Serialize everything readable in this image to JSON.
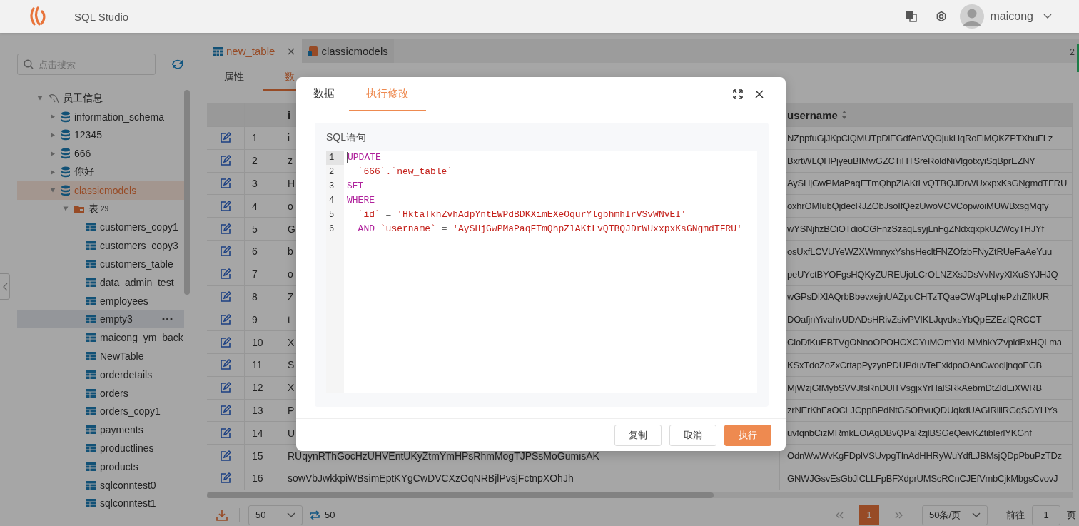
{
  "header": {
    "title": "SQL Studio",
    "user": "maicong"
  },
  "sidebar": {
    "search": {
      "placeholder": "点击搜索"
    },
    "tree": [
      {
        "label": "员工信息",
        "kind": "connection",
        "expanded": true,
        "selected": false,
        "children": [
          {
            "label": "information_schema",
            "kind": "database",
            "expanded": false,
            "selected": false
          },
          {
            "label": "12345",
            "kind": "database",
            "expanded": false,
            "selected": false
          },
          {
            "label": "666",
            "kind": "database",
            "expanded": false,
            "selected": false
          },
          {
            "label": "你好",
            "kind": "database",
            "expanded": false,
            "selected": false
          },
          {
            "label": "classicmodels",
            "kind": "database",
            "expanded": true,
            "selected": true,
            "children": [
              {
                "label": "表",
                "kind": "folder",
                "count": "29",
                "expanded": true,
                "selected": false,
                "children": [
                  {
                    "label": "customers_copy1",
                    "kind": "table",
                    "selected": false,
                    "hovered": false
                  },
                  {
                    "label": "customers_copy3",
                    "kind": "table",
                    "selected": false,
                    "hovered": false
                  },
                  {
                    "label": "customers_table",
                    "kind": "table",
                    "selected": false,
                    "hovered": false
                  },
                  {
                    "label": "data_admin_test",
                    "kind": "table",
                    "selected": false,
                    "hovered": false
                  },
                  {
                    "label": "employees",
                    "kind": "table",
                    "selected": false,
                    "hovered": false
                  },
                  {
                    "label": "empty3",
                    "kind": "table",
                    "selected": false,
                    "hovered": true
                  },
                  {
                    "label": "maicong_ym_back",
                    "kind": "table",
                    "selected": false,
                    "hovered": false
                  },
                  {
                    "label": "NewTable",
                    "kind": "table",
                    "selected": false,
                    "hovered": false
                  },
                  {
                    "label": "orderdetails",
                    "kind": "table",
                    "selected": false,
                    "hovered": false
                  },
                  {
                    "label": "orders",
                    "kind": "table",
                    "selected": false,
                    "hovered": false
                  },
                  {
                    "label": "orders_copy1",
                    "kind": "table",
                    "selected": false,
                    "hovered": false
                  },
                  {
                    "label": "payments",
                    "kind": "table",
                    "selected": false,
                    "hovered": false
                  },
                  {
                    "label": "productlines",
                    "kind": "table",
                    "selected": false,
                    "hovered": false
                  },
                  {
                    "label": "products",
                    "kind": "table",
                    "selected": false,
                    "hovered": false
                  },
                  {
                    "label": "sqlconntest0",
                    "kind": "table",
                    "selected": false,
                    "hovered": false
                  },
                  {
                    "label": "sqlconntest1",
                    "kind": "table",
                    "selected": false,
                    "hovered": false
                  }
                ]
              }
            ]
          }
        ]
      }
    ]
  },
  "editor_tabs": [
    {
      "label": "new_table",
      "kind": "table",
      "selected": true,
      "closable": true
    },
    {
      "label": "classicmodels",
      "kind": "database",
      "selected": false,
      "closable": false
    }
  ],
  "edge_label": "2",
  "view_tabs": [
    {
      "label": "属性",
      "selected": false
    },
    {
      "label": "数",
      "selected": true
    }
  ],
  "table": {
    "columns": [
      {
        "label": "i",
        "sortable": false
      },
      {
        "label": "username",
        "sortable": true
      }
    ],
    "rows": [
      {
        "number": "1",
        "id": "i",
        "username": "NZppfuGjJKpCiQMUTpDiEGdfAnVQOjukHqRoFlMQKZPTXhuFLz"
      },
      {
        "number": "2",
        "id": "z",
        "username": "BxrtWLQHPjyeuBIMwGZCTiHTSreRoldNiVlgotxyiSqBprEZNY"
      },
      {
        "number": "3",
        "id": "H",
        "username": "AySHjGwPMaPaqFTmQhpZlAKtLvQTBQJDrWUxxpxKsGNgmdTFRU"
      },
      {
        "number": "4",
        "id": "o",
        "username": "oxhrOMIubQjdecRJZObJsoIfQezUwoVCVCopwoiMUWBxsgMqfy"
      },
      {
        "number": "5",
        "id": "G",
        "username": "wYSNjhzBCiOTdioCGFnzSzaqLsyjLnFgZNdxqxpkUZWcyTHJYf"
      },
      {
        "number": "6",
        "id": "b",
        "username": "osUxfLCVUYeWZXWmnyxYshsHecltFNZOfzbFNyZtRUeFaAeYuu"
      },
      {
        "number": "7",
        "id": "o",
        "username": "peUYctBYOFgsHQKyZUREUjoLCrOLNZXsJDsVvNvyXlXuSYJHJQ"
      },
      {
        "number": "8",
        "id": "Z",
        "username": "wGPsDlXlAQrbBbevxejnUAZpuCHTzTQaeCWqPLqhePzhZflkUR"
      },
      {
        "number": "9",
        "id": "t",
        "username": "DOafjnYivahvUDADsHRivZsivPVIKLJqvdxsYbQpEZEzIQRCCT"
      },
      {
        "number": "10",
        "id": "X",
        "username": "CloDfKuEBTVgONnoOPOHCXCYuMOmYkLMMhkYZvpldBxHQLma"
      },
      {
        "number": "11",
        "id": "S",
        "username": "KSxTdoZoZxCrtapPyzynPDUPduvTeExkipoOAnCwoqijnqoEGB"
      },
      {
        "number": "12",
        "id": "X",
        "username": "MjWzjGfMybSVVJfsRnDUlTVsgjxYrHalSRkAebmDtZldEiXWRB"
      },
      {
        "number": "13",
        "id": "P",
        "username": "zrNErKhFaOCLJCppBPdNtGSOBvuQDUqkdUAGIRiilRGqSGYHYs"
      },
      {
        "number": "14",
        "id": "U",
        "username": "uvfqnbCizMRmkEOiAgDBvQPaRzjlBSGeQeivKZtiblerlYKGnf"
      },
      {
        "number": "15",
        "id": "RUqynRThGocHzUHVEntUKyZtmYmHPsRhmMogTJPSsMoGumisAK",
        "username": "OdnWwWvKgFDplVSUvpgTlnAdHHRyWuYdfLJBMsjQDpPbuPzTDz"
      },
      {
        "number": "16",
        "id": "sowVbJwkkpiWBsimEptKYgCwDVCXzOqNRBjlPvsjFctnpXOhJh",
        "username": "GNWJGsvEsGbJlCLLFpBFXdprUMScRCnCJEfVmbCjkMbgsCvovJ"
      }
    ]
  },
  "footer": {
    "page_size": "50",
    "row_count": "50",
    "pages": [
      {
        "label": "1",
        "selected": true
      }
    ],
    "page_size_label": "50条/页",
    "goto_label": "前往",
    "goto_value": "1",
    "goto_suffix": "页"
  },
  "dialog": {
    "tabs": [
      {
        "label": "数据",
        "selected": false
      },
      {
        "label": "执行修改",
        "selected": true
      }
    ],
    "section_title": "SQL语句",
    "lines": [
      {
        "number": "1",
        "active": true,
        "tokens": [
          {
            "kind": "keyword",
            "text": "UPDATE"
          }
        ]
      },
      {
        "number": "2",
        "active": false,
        "tokens": [
          {
            "kind": "identifier",
            "text": "  `666`.`new_table`"
          }
        ]
      },
      {
        "number": "3",
        "active": false,
        "tokens": [
          {
            "kind": "keyword",
            "text": "SET"
          }
        ]
      },
      {
        "number": "4",
        "active": false,
        "tokens": [
          {
            "kind": "keyword",
            "text": "WHERE"
          }
        ]
      },
      {
        "number": "5",
        "active": false,
        "tokens": [
          {
            "kind": "identifier",
            "text": "  `id`"
          },
          {
            "kind": "operator",
            "text": " = "
          },
          {
            "kind": "string",
            "text": "'HktaTkhZvhAdpYntEWPdBDKXimEXeOqurYlgbhmhIrVSvWNvEI'"
          }
        ]
      },
      {
        "number": "6",
        "active": false,
        "tokens": [
          {
            "kind": "keyword",
            "text": "  AND "
          },
          {
            "kind": "identifier",
            "text": "`username`"
          },
          {
            "kind": "operator",
            "text": " = "
          },
          {
            "kind": "string",
            "text": "'AySHjGwPMaPaqFTmQhpZlAKtLvQTBQJDrWUxxpxKsGNgmdTFRU'"
          }
        ]
      }
    ],
    "buttons": [
      {
        "label": "复制",
        "kind": "default"
      },
      {
        "label": "取消",
        "kind": "default"
      },
      {
        "label": "执行",
        "kind": "primary"
      }
    ]
  }
}
